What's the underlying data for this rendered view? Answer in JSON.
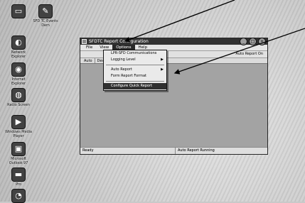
{
  "desktop": {
    "icons": [
      {
        "name": "my-documents-icon",
        "label": "",
        "glyph": "▭"
      },
      {
        "name": "sfdtc-icon",
        "label": "SFD TC Events Dem",
        "glyph": "✎"
      },
      {
        "name": "network-icon",
        "label": "Network Explorer",
        "glyph": "◐"
      },
      {
        "name": "internet-icon",
        "label": "Internet Explorer",
        "glyph": "◉"
      },
      {
        "name": "radio-icon",
        "label": "Radio Screen",
        "glyph": "◍"
      },
      {
        "name": "windows-media-icon",
        "label": "Windows Media Player",
        "glyph": "▶"
      },
      {
        "name": "outlook-icon",
        "label": "Microsoft Outlook 97",
        "glyph": "▣"
      },
      {
        "name": "folder-icon",
        "label": "Pro",
        "glyph": "▬"
      },
      {
        "name": "bottom-icon",
        "label": "",
        "glyph": "◔"
      }
    ]
  },
  "window": {
    "title": "SFDTC Report Configuration",
    "menu": [
      "File",
      "View",
      "Options",
      "Help"
    ],
    "active_menu_index": 2,
    "toolbar_right": "Auto Report On",
    "columns": [
      "Auto",
      "Device"
    ],
    "status_left": "Ready",
    "status_right": "Auto Report Running"
  },
  "dropdown": {
    "items": [
      {
        "label": "LPR-SFD Communications",
        "arrow": ""
      },
      {
        "label": "Logging Level",
        "arrow": "▶"
      },
      {
        "sep": true
      },
      {
        "label": "Auto Report",
        "arrow": "▶"
      },
      {
        "label": "Form Report Format",
        "arrow": ""
      },
      {
        "sep": true
      },
      {
        "label": "Configure Quick Report",
        "arrow": "",
        "highlight": true
      }
    ]
  }
}
